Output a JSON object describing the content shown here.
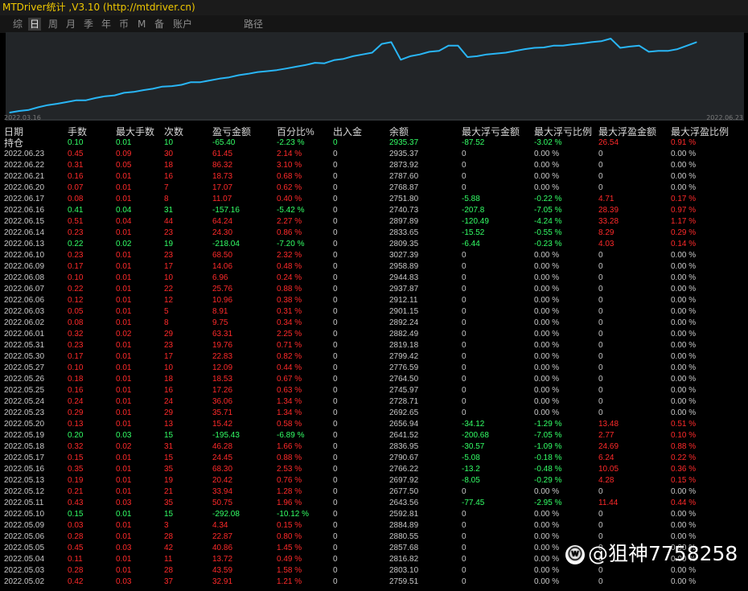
{
  "window": {
    "title": "MTDriver统计 ,V3.10 (http://mtdriver.cn)"
  },
  "menu": [
    {
      "label": "综",
      "active": false
    },
    {
      "label": "日",
      "active": true
    },
    {
      "label": "周",
      "active": false
    },
    {
      "label": "月",
      "active": false
    },
    {
      "label": "季",
      "active": false
    },
    {
      "label": "年",
      "active": false
    },
    {
      "label": "币",
      "active": false
    },
    {
      "label": "M",
      "active": false
    },
    {
      "label": "备",
      "active": false
    },
    {
      "label": "账户",
      "active": false
    },
    {
      "label": "路径",
      "active": false
    }
  ],
  "chart_data": {
    "type": "line",
    "title": "",
    "xlabel": "",
    "ylabel": "",
    "color": "#29b6f6",
    "start_label": "2022.03.16",
    "end_label": "2022.06.23",
    "points": [
      {
        "d": "2022.03.16",
        "v": 2000
      },
      {
        "d": "2022.03.17",
        "v": 2018
      },
      {
        "d": "2022.03.18",
        "v": 2030
      },
      {
        "d": "2022.03.21",
        "v": 2060
      },
      {
        "d": "2022.03.22",
        "v": 2085
      },
      {
        "d": "2022.03.23",
        "v": 2100
      },
      {
        "d": "2022.03.24",
        "v": 2120
      },
      {
        "d": "2022.03.25",
        "v": 2140
      },
      {
        "d": "2022.03.28",
        "v": 2140
      },
      {
        "d": "2022.03.29",
        "v": 2165
      },
      {
        "d": "2022.03.30",
        "v": 2185
      },
      {
        "d": "2022.03.31",
        "v": 2195
      },
      {
        "d": "2022.04.01",
        "v": 2225
      },
      {
        "d": "2022.04.04",
        "v": 2235
      },
      {
        "d": "2022.04.05",
        "v": 2255
      },
      {
        "d": "2022.04.06",
        "v": 2270
      },
      {
        "d": "2022.04.07",
        "v": 2295
      },
      {
        "d": "2022.04.08",
        "v": 2300
      },
      {
        "d": "2022.04.11",
        "v": 2315
      },
      {
        "d": "2022.04.12",
        "v": 2345
      },
      {
        "d": "2022.04.13",
        "v": 2345
      },
      {
        "d": "2022.04.14",
        "v": 2365
      },
      {
        "d": "2022.04.15",
        "v": 2385
      },
      {
        "d": "2022.04.18",
        "v": 2400
      },
      {
        "d": "2022.04.19",
        "v": 2425
      },
      {
        "d": "2022.04.20",
        "v": 2440
      },
      {
        "d": "2022.04.21",
        "v": 2460
      },
      {
        "d": "2022.04.22",
        "v": 2470
      },
      {
        "d": "2022.04.25",
        "v": 2482
      },
      {
        "d": "2022.04.26",
        "v": 2500
      },
      {
        "d": "2022.04.27",
        "v": 2520
      },
      {
        "d": "2022.04.28",
        "v": 2540
      },
      {
        "d": "2022.04.29",
        "v": 2565
      },
      {
        "d": "2022.05.02",
        "v": 2560
      },
      {
        "d": "2022.05.03",
        "v": 2595
      },
      {
        "d": "2022.05.04",
        "v": 2610
      },
      {
        "d": "2022.05.05",
        "v": 2640
      },
      {
        "d": "2022.05.06",
        "v": 2660
      },
      {
        "d": "2022.05.09",
        "v": 2680
      },
      {
        "d": "2022.05.10",
        "v": 2780
      },
      {
        "d": "2022.05.11",
        "v": 2800
      },
      {
        "d": "2022.05.12",
        "v": 2600
      },
      {
        "d": "2022.05.13",
        "v": 2640
      },
      {
        "d": "2022.05.16",
        "v": 2660
      },
      {
        "d": "2022.05.17",
        "v": 2690
      },
      {
        "d": "2022.05.18",
        "v": 2700
      },
      {
        "d": "2022.05.19",
        "v": 2760
      },
      {
        "d": "2022.05.20",
        "v": 2760
      },
      {
        "d": "2022.05.23",
        "v": 2630
      },
      {
        "d": "2022.05.24",
        "v": 2640
      },
      {
        "d": "2022.05.25",
        "v": 2660
      },
      {
        "d": "2022.05.26",
        "v": 2670
      },
      {
        "d": "2022.05.27",
        "v": 2680
      },
      {
        "d": "2022.05.30",
        "v": 2700
      },
      {
        "d": "2022.05.31",
        "v": 2720
      },
      {
        "d": "2022.06.01",
        "v": 2735
      },
      {
        "d": "2022.06.02",
        "v": 2740
      },
      {
        "d": "2022.06.03",
        "v": 2760
      },
      {
        "d": "2022.06.06",
        "v": 2760
      },
      {
        "d": "2022.06.07",
        "v": 2775
      },
      {
        "d": "2022.06.08",
        "v": 2785
      },
      {
        "d": "2022.06.09",
        "v": 2800
      },
      {
        "d": "2022.06.10",
        "v": 2810
      },
      {
        "d": "2022.06.13",
        "v": 2840
      },
      {
        "d": "2022.06.14",
        "v": 2735
      },
      {
        "d": "2022.06.15",
        "v": 2750
      },
      {
        "d": "2022.06.16",
        "v": 2760
      },
      {
        "d": "2022.06.17",
        "v": 2690
      },
      {
        "d": "2022.06.20",
        "v": 2700
      },
      {
        "d": "2022.06.21",
        "v": 2700
      },
      {
        "d": "2022.06.22",
        "v": 2720
      },
      {
        "d": "2022.06.23",
        "v": 2760
      },
      {
        "d": "2022.06.24",
        "v": 2800
      }
    ]
  },
  "table": {
    "headers": [
      "日期",
      "手数",
      "最大手数",
      "次数",
      "盈亏金额",
      "百分比%",
      "出入金",
      "余额",
      "最大浮亏金额",
      "最大浮亏比例",
      "最大浮盈金额",
      "最大浮盈比例"
    ],
    "holding": [
      "持仓",
      "0.10",
      "0.01",
      "10",
      "-65.40",
      "-2.23 %",
      "0",
      "2935.37",
      "-87.52",
      "-3.02 %",
      "26.54",
      "0.91 %"
    ],
    "rows": [
      [
        "2022.06.23",
        "0.45",
        "0.09",
        "30",
        "61.45",
        "2.14 %",
        "0",
        "2935.37",
        "0",
        "0.00 %",
        "0",
        "0.00 %"
      ],
      [
        "2022.06.22",
        "0.31",
        "0.05",
        "18",
        "86.32",
        "3.10 %",
        "0",
        "2873.92",
        "0",
        "0.00 %",
        "0",
        "0.00 %"
      ],
      [
        "2022.06.21",
        "0.16",
        "0.01",
        "16",
        "18.73",
        "0.68 %",
        "0",
        "2787.60",
        "0",
        "0.00 %",
        "0",
        "0.00 %"
      ],
      [
        "2022.06.20",
        "0.07",
        "0.01",
        "7",
        "17.07",
        "0.62 %",
        "0",
        "2768.87",
        "0",
        "0.00 %",
        "0",
        "0.00 %"
      ],
      [
        "2022.06.17",
        "0.08",
        "0.01",
        "8",
        "11.07",
        "0.40 %",
        "0",
        "2751.80",
        "-5.88",
        "-0.22 %",
        "4.71",
        "0.17 %"
      ],
      [
        "2022.06.16",
        "0.41",
        "0.04",
        "31",
        "-157.16",
        "-5.42 %",
        "0",
        "2740.73",
        "-207.8",
        "-7.05 %",
        "28.39",
        "0.97 %"
      ],
      [
        "2022.06.15",
        "0.51",
        "0.04",
        "44",
        "64.24",
        "2.27 %",
        "0",
        "2897.89",
        "-120.49",
        "-4.24 %",
        "33.28",
        "1.17 %"
      ],
      [
        "2022.06.14",
        "0.23",
        "0.01",
        "23",
        "24.30",
        "0.86 %",
        "0",
        "2833.65",
        "-15.52",
        "-0.55 %",
        "8.29",
        "0.29 %"
      ],
      [
        "2022.06.13",
        "0.22",
        "0.02",
        "19",
        "-218.04",
        "-7.20 %",
        "0",
        "2809.35",
        "-6.44",
        "-0.23 %",
        "4.03",
        "0.14 %"
      ],
      [
        "2022.06.10",
        "0.23",
        "0.01",
        "23",
        "68.50",
        "2.32 %",
        "0",
        "3027.39",
        "0",
        "0.00 %",
        "0",
        "0.00 %"
      ],
      [
        "2022.06.09",
        "0.17",
        "0.01",
        "17",
        "14.06",
        "0.48 %",
        "0",
        "2958.89",
        "0",
        "0.00 %",
        "0",
        "0.00 %"
      ],
      [
        "2022.06.08",
        "0.10",
        "0.01",
        "10",
        "6.96",
        "0.24 %",
        "0",
        "2944.83",
        "0",
        "0.00 %",
        "0",
        "0.00 %"
      ],
      [
        "2022.06.07",
        "0.22",
        "0.01",
        "22",
        "25.76",
        "0.88 %",
        "0",
        "2937.87",
        "0",
        "0.00 %",
        "0",
        "0.00 %"
      ],
      [
        "2022.06.06",
        "0.12",
        "0.01",
        "12",
        "10.96",
        "0.38 %",
        "0",
        "2912.11",
        "0",
        "0.00 %",
        "0",
        "0.00 %"
      ],
      [
        "2022.06.03",
        "0.05",
        "0.01",
        "5",
        "8.91",
        "0.31 %",
        "0",
        "2901.15",
        "0",
        "0.00 %",
        "0",
        "0.00 %"
      ],
      [
        "2022.06.02",
        "0.08",
        "0.01",
        "8",
        "9.75",
        "0.34 %",
        "0",
        "2892.24",
        "0",
        "0.00 %",
        "0",
        "0.00 %"
      ],
      [
        "2022.06.01",
        "0.32",
        "0.02",
        "29",
        "63.31",
        "2.25 %",
        "0",
        "2882.49",
        "0",
        "0.00 %",
        "0",
        "0.00 %"
      ],
      [
        "2022.05.31",
        "0.23",
        "0.01",
        "23",
        "19.76",
        "0.71 %",
        "0",
        "2819.18",
        "0",
        "0.00 %",
        "0",
        "0.00 %"
      ],
      [
        "2022.05.30",
        "0.17",
        "0.01",
        "17",
        "22.83",
        "0.82 %",
        "0",
        "2799.42",
        "0",
        "0.00 %",
        "0",
        "0.00 %"
      ],
      [
        "2022.05.27",
        "0.10",
        "0.01",
        "10",
        "12.09",
        "0.44 %",
        "0",
        "2776.59",
        "0",
        "0.00 %",
        "0",
        "0.00 %"
      ],
      [
        "2022.05.26",
        "0.18",
        "0.01",
        "18",
        "18.53",
        "0.67 %",
        "0",
        "2764.50",
        "0",
        "0.00 %",
        "0",
        "0.00 %"
      ],
      [
        "2022.05.25",
        "0.16",
        "0.01",
        "16",
        "17.26",
        "0.63 %",
        "0",
        "2745.97",
        "0",
        "0.00 %",
        "0",
        "0.00 %"
      ],
      [
        "2022.05.24",
        "0.24",
        "0.01",
        "24",
        "36.06",
        "1.34 %",
        "0",
        "2728.71",
        "0",
        "0.00 %",
        "0",
        "0.00 %"
      ],
      [
        "2022.05.23",
        "0.29",
        "0.01",
        "29",
        "35.71",
        "1.34 %",
        "0",
        "2692.65",
        "0",
        "0.00 %",
        "0",
        "0.00 %"
      ],
      [
        "2022.05.20",
        "0.13",
        "0.01",
        "13",
        "15.42",
        "0.58 %",
        "0",
        "2656.94",
        "-34.12",
        "-1.29 %",
        "13.48",
        "0.51 %"
      ],
      [
        "2022.05.19",
        "0.20",
        "0.03",
        "15",
        "-195.43",
        "-6.89 %",
        "0",
        "2641.52",
        "-200.68",
        "-7.05 %",
        "2.77",
        "0.10 %"
      ],
      [
        "2022.05.18",
        "0.32",
        "0.02",
        "31",
        "46.28",
        "1.66 %",
        "0",
        "2836.95",
        "-30.57",
        "-1.09 %",
        "24.69",
        "0.88 %"
      ],
      [
        "2022.05.17",
        "0.15",
        "0.01",
        "15",
        "24.45",
        "0.88 %",
        "0",
        "2790.67",
        "-5.08",
        "-0.18 %",
        "6.24",
        "0.22 %"
      ],
      [
        "2022.05.16",
        "0.35",
        "0.01",
        "35",
        "68.30",
        "2.53 %",
        "0",
        "2766.22",
        "-13.2",
        "-0.48 %",
        "10.05",
        "0.36 %"
      ],
      [
        "2022.05.13",
        "0.19",
        "0.01",
        "19",
        "20.42",
        "0.76 %",
        "0",
        "2697.92",
        "-8.05",
        "-0.29 %",
        "4.28",
        "0.15 %"
      ],
      [
        "2022.05.12",
        "0.21",
        "0.01",
        "21",
        "33.94",
        "1.28 %",
        "0",
        "2677.50",
        "0",
        "0.00 %",
        "0",
        "0.00 %"
      ],
      [
        "2022.05.11",
        "0.43",
        "0.03",
        "35",
        "50.75",
        "1.96 %",
        "0",
        "2643.56",
        "-77.45",
        "-2.95 %",
        "11.44",
        "0.44 %"
      ],
      [
        "2022.05.10",
        "0.15",
        "0.01",
        "15",
        "-292.08",
        "-10.12 %",
        "0",
        "2592.81",
        "0",
        "0.00 %",
        "0",
        "0.00 %"
      ],
      [
        "2022.05.09",
        "0.03",
        "0.01",
        "3",
        "4.34",
        "0.15 %",
        "0",
        "2884.89",
        "0",
        "0.00 %",
        "0",
        "0.00 %"
      ],
      [
        "2022.05.06",
        "0.28",
        "0.01",
        "28",
        "22.87",
        "0.80 %",
        "0",
        "2880.55",
        "0",
        "0.00 %",
        "0",
        "0.00 %"
      ],
      [
        "2022.05.05",
        "0.45",
        "0.03",
        "42",
        "40.86",
        "1.45 %",
        "0",
        "2857.68",
        "0",
        "0.00 %",
        "0",
        "0.00 %"
      ],
      [
        "2022.05.04",
        "0.11",
        "0.01",
        "11",
        "13.72",
        "0.49 %",
        "0",
        "2816.82",
        "0",
        "0.00 %",
        "0",
        "0.00 %"
      ],
      [
        "2022.05.03",
        "0.28",
        "0.01",
        "28",
        "43.59",
        "1.58 %",
        "0",
        "2803.10",
        "0",
        "0.00 %",
        "0",
        "0.00 %"
      ],
      [
        "2022.05.02",
        "0.42",
        "0.03",
        "37",
        "32.91",
        "1.21 %",
        "0",
        "2759.51",
        "0",
        "0.00 %",
        "0",
        "0.00 %"
      ]
    ]
  },
  "watermark": {
    "icon": "weibo-icon",
    "text": "@狙神7758258"
  }
}
